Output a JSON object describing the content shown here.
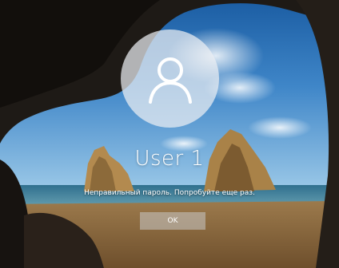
{
  "lock_screen": {
    "user_name": "User 1",
    "error_message": "Неправильный пароль. Попробуйте еще раз.",
    "ok_button_label": "OK",
    "avatar_icon": "user-silhouette-icon"
  },
  "colors": {
    "avatar_circle": "#eceef2",
    "text": "#ffffff",
    "button": "#c8c8c8"
  }
}
